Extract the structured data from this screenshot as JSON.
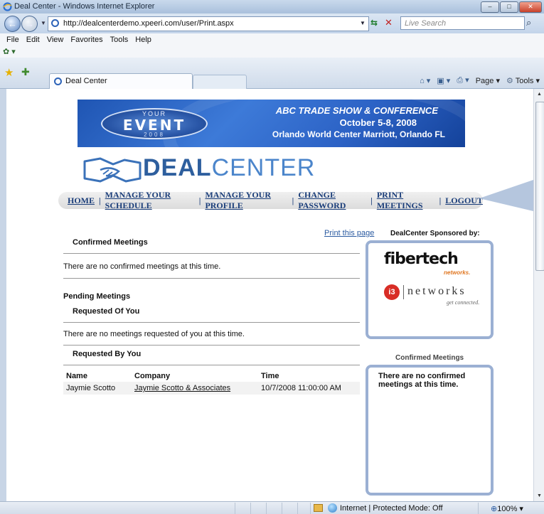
{
  "window": {
    "title": "Deal Center - Windows Internet Explorer",
    "controls": {
      "minimize": "–",
      "maximize": "□",
      "close": "✕"
    }
  },
  "address_bar": {
    "url": "http://dealcenterdemo.xpeeri.com/user/Print.aspx",
    "refresh_icon": "refresh-icon",
    "stop_icon": "stop-icon"
  },
  "search": {
    "placeholder": "Live Search"
  },
  "menu": {
    "items": [
      "File",
      "Edit",
      "View",
      "Favorites",
      "Tools",
      "Help"
    ]
  },
  "tab": {
    "label": "Deal Center"
  },
  "command_bar": {
    "page_label": "Page",
    "tools_label": "Tools"
  },
  "banner": {
    "logo_top": "YOUR",
    "logo_main": "EVENT",
    "logo_year": "2008",
    "line1": "ABC TRADE SHOW & CONFERENCE",
    "line2": "October 5-8, 2008",
    "line3": "Orlando World Center Marriott, Orlando FL"
  },
  "brand": {
    "deal": "DEAL",
    "center": "CENTER"
  },
  "nav": {
    "items": [
      "HOME",
      "MANAGE YOUR SCHEDULE",
      "MANAGE YOUR PROFILE",
      "CHANGE PASSWORD",
      "PRINT MEETINGS",
      "LOGOUT"
    ],
    "separator": "|"
  },
  "print_link": "Print this page",
  "confirmed": {
    "heading": "Confirmed Meetings",
    "message": "There are no confirmed meetings at this time."
  },
  "pending": {
    "heading": "Pending Meetings",
    "requested_of_you": {
      "heading": "Requested Of You",
      "message": "There are no meetings requested of you at this time."
    },
    "requested_by_you": {
      "heading": "Requested By You",
      "columns": [
        "Name",
        "Company",
        "Time"
      ],
      "rows": [
        {
          "name": "Jaymie Scotto",
          "company": "Jaymie Scotto & Associates",
          "time": "10/7/2008 11:00:00 AM"
        }
      ]
    }
  },
  "sponsors": {
    "title": "DealCenter Sponsored by:",
    "fibertech": {
      "name": "fibertech",
      "sub": "networks."
    },
    "i3": {
      "mark": "i3",
      "name": "networks",
      "tagline": "get connected."
    }
  },
  "sidebar_confirmed": {
    "title": "Confirmed Meetings",
    "message": "There are no confirmed meetings at this time."
  },
  "status_bar": {
    "zone": "Internet | Protected Mode: Off",
    "zoom": "100%"
  },
  "colors": {
    "brand_blue": "#3b72b9",
    "nav_link": "#1b3e7a",
    "sponsor_border": "#9bb0d3",
    "i3_red": "#d82d26",
    "fibertech_orange": "#e07722"
  }
}
